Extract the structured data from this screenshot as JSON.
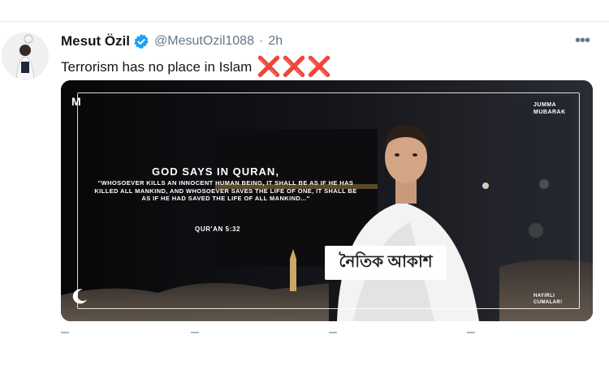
{
  "tweet": {
    "display_name": "Mesut Özil",
    "handle": "@MesutOzil1088",
    "separator": "·",
    "time": "2h",
    "more_label": "•••",
    "text": "Terrorism has no place in Islam",
    "emoji": "❌❌❌"
  },
  "media": {
    "logo_text": "M",
    "top_right": "JUMMA\nMUBARAK",
    "headline": "GOD SAYS IN QURAN,",
    "quote": "\"WHOSOEVER KILLS AN INNOCENT HUMAN BEING, IT SHALL BE AS IF HE HAS KILLED ALL MANKIND, AND WHOSOEVER SAVES THE LIFE OF ONE, IT SHALL BE AS IF HE HAD SAVED THE LIFE OF ALL MANKIND...\"",
    "reference": "QUR'AN 5:32",
    "bottom_right": "HAYIRLI\nCUMALAR!",
    "watermark": "নৈতিক আকাশ"
  },
  "colors": {
    "verified": "#1da1f2",
    "text": "#14171a",
    "muted": "#657786",
    "red_x": "#d8262c"
  }
}
